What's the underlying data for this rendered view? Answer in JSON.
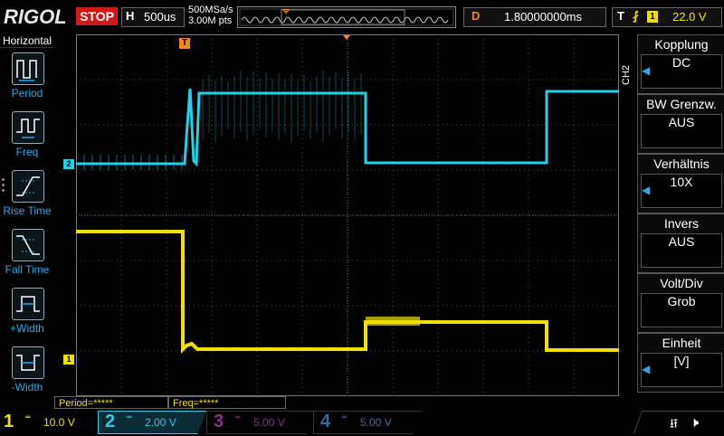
{
  "top": {
    "brand": "RIGOL",
    "run_state": "STOP",
    "h_label": "H",
    "timebase": "500us",
    "sample_rate": "500MSa/s",
    "mem_depth": "3.00M pts",
    "delay_label": "D",
    "delay": "1.80000000ms",
    "trig_label": "T",
    "trig_channel": "1",
    "trig_level": "22.0 V"
  },
  "left_menu": {
    "title": "Horizontal",
    "items": [
      {
        "label": "Period",
        "icon": "period-icon"
      },
      {
        "label": "Freq",
        "icon": "frequency-icon"
      },
      {
        "label": "Rise Time",
        "icon": "rise-time-icon"
      },
      {
        "label": "Fall Time",
        "icon": "fall-time-icon"
      },
      {
        "label": "+Width",
        "icon": "positive-width-icon"
      },
      {
        "label": "-Width",
        "icon": "negative-width-icon"
      }
    ]
  },
  "right_menu": {
    "channel_tag": "CH2",
    "items": [
      {
        "title": "Kopplung",
        "value": "DC",
        "has_arrow": true
      },
      {
        "title": "BW Grenzw.",
        "value": "AUS",
        "has_arrow": false
      },
      {
        "title": "Verhältnis",
        "value": "10X",
        "has_arrow": true
      },
      {
        "title": "Invers",
        "value": "AUS",
        "has_arrow": false
      },
      {
        "title": "Volt/Div",
        "value": "Grob",
        "has_arrow": false
      },
      {
        "title": "Einheit",
        "value": "[V]",
        "has_arrow": true
      }
    ]
  },
  "measurements": {
    "period": "Period=*****",
    "freq": "Freq=*****"
  },
  "channels": [
    {
      "num": "1",
      "scale": "10.0 V"
    },
    {
      "num": "2",
      "scale": "2.00 V"
    },
    {
      "num": "3",
      "scale": "5.00 V"
    },
    {
      "num": "4",
      "scale": "5.00 V"
    }
  ],
  "markers": {
    "ch1": "1",
    "ch2": "2",
    "trigger": "T"
  },
  "colors": {
    "ch1": "#f0e000",
    "ch2": "#22d0e8",
    "ch3": "#8a2e8a",
    "ch4": "#3a6aa0",
    "trigger": "#f08a1c",
    "stop": "#d01818"
  }
}
